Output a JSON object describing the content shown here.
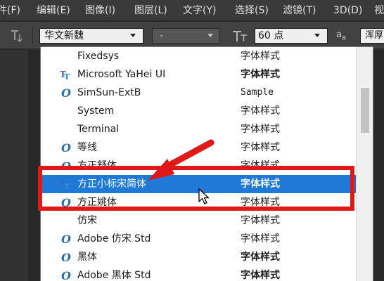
{
  "menu": {
    "items": [
      {
        "key": "file",
        "label": "件(F)"
      },
      {
        "key": "edit",
        "label": "编辑(E)"
      },
      {
        "key": "image",
        "label": "图像(I)"
      },
      {
        "key": "layer",
        "label": "图层(L)"
      },
      {
        "key": "type",
        "label": "文字(Y)"
      },
      {
        "key": "select",
        "label": "选择(S)"
      },
      {
        "key": "filter",
        "label": "滤镜(T)"
      },
      {
        "key": "3d",
        "label": "3D(D)"
      },
      {
        "key": "view",
        "label": "视"
      }
    ]
  },
  "options": {
    "tool_icon": "type-tool-orientation-icon",
    "font_family": "华文新魏",
    "font_style": "-",
    "size_icon": "font-size-icon",
    "font_size": "60 点",
    "aa_label": "a",
    "aa_sub": "a",
    "aa_mode": "浑厚"
  },
  "font_list": {
    "items": [
      {
        "name": "Fixedsys",
        "sample": "字体样式",
        "icon": "none",
        "sample_style": "normal"
      },
      {
        "name": "Microsoft YaHei UI",
        "sample": "字体样式",
        "icon": "truetype-icon",
        "sample_style": "bold"
      },
      {
        "name": "SimSun-ExtB",
        "sample": "Sample",
        "icon": "opentype-icon",
        "sample_style": "mono"
      },
      {
        "name": "System",
        "sample": "字体样式",
        "icon": "none",
        "sample_style": "normal"
      },
      {
        "name": "Terminal",
        "sample": "字体样式",
        "icon": "none",
        "sample_style": "normal"
      },
      {
        "name": "等线",
        "sample": "字体样式",
        "icon": "opentype-icon",
        "sample_style": "normal"
      },
      {
        "name": "方正舒体",
        "sample": "字体样式",
        "icon": "opentype-icon",
        "sample_style": "normal"
      },
      {
        "name": "方正小标宋简体",
        "sample": "字体样式",
        "icon": "truetype-icon",
        "sample_style": "bold",
        "selected": true
      },
      {
        "name": "方正姚体",
        "sample": "字体样式",
        "icon": "opentype-icon",
        "sample_style": "normal"
      },
      {
        "name": "仿宋",
        "sample": "字体样式",
        "icon": "none",
        "sample_style": "normal"
      },
      {
        "name": "Adobe 仿宋 Std",
        "sample": "字体样式",
        "icon": "opentype-icon",
        "sample_style": "normal"
      },
      {
        "name": "黑体",
        "sample": "字体样式",
        "icon": "opentype-icon",
        "sample_style": "bold"
      },
      {
        "name": "Adobe 黑体 Std",
        "sample": "字体样式",
        "icon": "opentype-icon",
        "sample_style": "bold"
      }
    ]
  },
  "colors": {
    "selected_row": "#1f7ad6",
    "annotation_red": "#e01818"
  }
}
